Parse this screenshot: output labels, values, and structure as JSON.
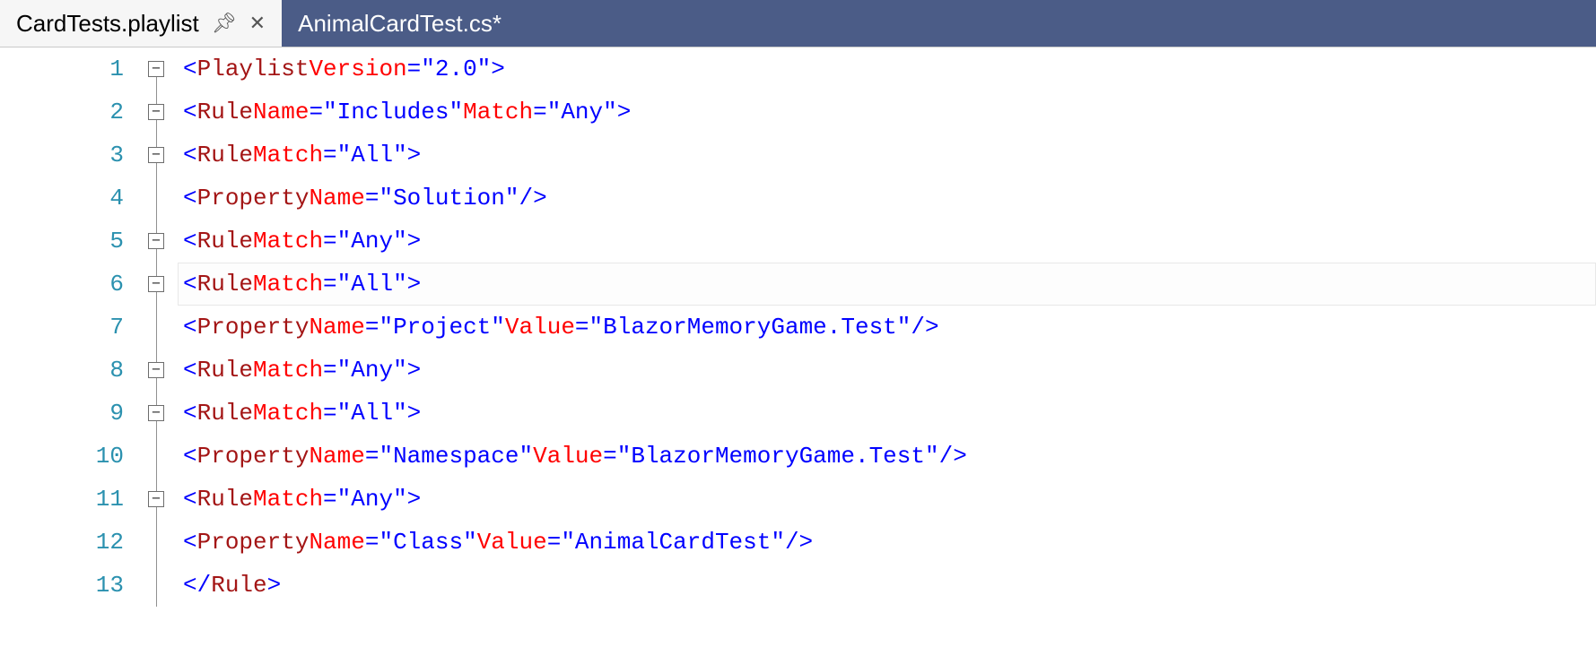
{
  "tabs": {
    "active": {
      "label": "CardTests.playlist"
    },
    "inactive": {
      "label": "AnimalCardTest.cs*"
    }
  },
  "lines": [
    {
      "num": "1",
      "fold": "minus",
      "indent": 0,
      "kind": "open",
      "tag": "Playlist",
      "attrs": [
        [
          "Version",
          "2.0"
        ]
      ]
    },
    {
      "num": "2",
      "fold": "minus",
      "indent": 1,
      "kind": "open",
      "tag": "Rule",
      "attrs": [
        [
          "Name",
          "Includes"
        ],
        [
          "Match",
          "Any"
        ]
      ]
    },
    {
      "num": "3",
      "fold": "minus",
      "indent": 2,
      "kind": "open",
      "tag": "Rule",
      "attrs": [
        [
          "Match",
          "All"
        ]
      ]
    },
    {
      "num": "4",
      "fold": "none",
      "indent": 3,
      "kind": "self",
      "tag": "Property",
      "attrs": [
        [
          "Name",
          "Solution"
        ]
      ]
    },
    {
      "num": "5",
      "fold": "minus",
      "indent": 3,
      "kind": "open",
      "tag": "Rule",
      "attrs": [
        [
          "Match",
          "Any"
        ]
      ]
    },
    {
      "num": "6",
      "fold": "minus",
      "indent": 4,
      "kind": "open",
      "tag": "Rule",
      "attrs": [
        [
          "Match",
          "All"
        ]
      ],
      "current": true
    },
    {
      "num": "7",
      "fold": "none",
      "indent": 5,
      "kind": "self",
      "tag": "Property",
      "attrs": [
        [
          "Name",
          "Project"
        ],
        [
          "Value",
          "BlazorMemoryGame.Test"
        ]
      ]
    },
    {
      "num": "8",
      "fold": "minus",
      "indent": 5,
      "kind": "open",
      "tag": "Rule",
      "attrs": [
        [
          "Match",
          "Any"
        ]
      ]
    },
    {
      "num": "9",
      "fold": "minus",
      "indent": 6,
      "kind": "open",
      "tag": "Rule",
      "attrs": [
        [
          "Match",
          "All"
        ]
      ]
    },
    {
      "num": "10",
      "fold": "none",
      "indent": 7,
      "kind": "self",
      "tag": "Property",
      "attrs": [
        [
          "Name",
          "Namespace"
        ],
        [
          "Value",
          "BlazorMemoryGame.Test"
        ]
      ]
    },
    {
      "num": "11",
      "fold": "minus",
      "indent": 7,
      "kind": "open",
      "tag": "Rule",
      "attrs": [
        [
          "Match",
          "Any"
        ]
      ]
    },
    {
      "num": "12",
      "fold": "none",
      "indent": 8,
      "kind": "self",
      "tag": "Property",
      "attrs": [
        [
          "Name",
          "Class"
        ],
        [
          "Value",
          "AnimalCardTest"
        ]
      ]
    },
    {
      "num": "13",
      "fold": "none",
      "indent": 7,
      "kind": "close",
      "tag": "Rule",
      "attrs": []
    }
  ]
}
